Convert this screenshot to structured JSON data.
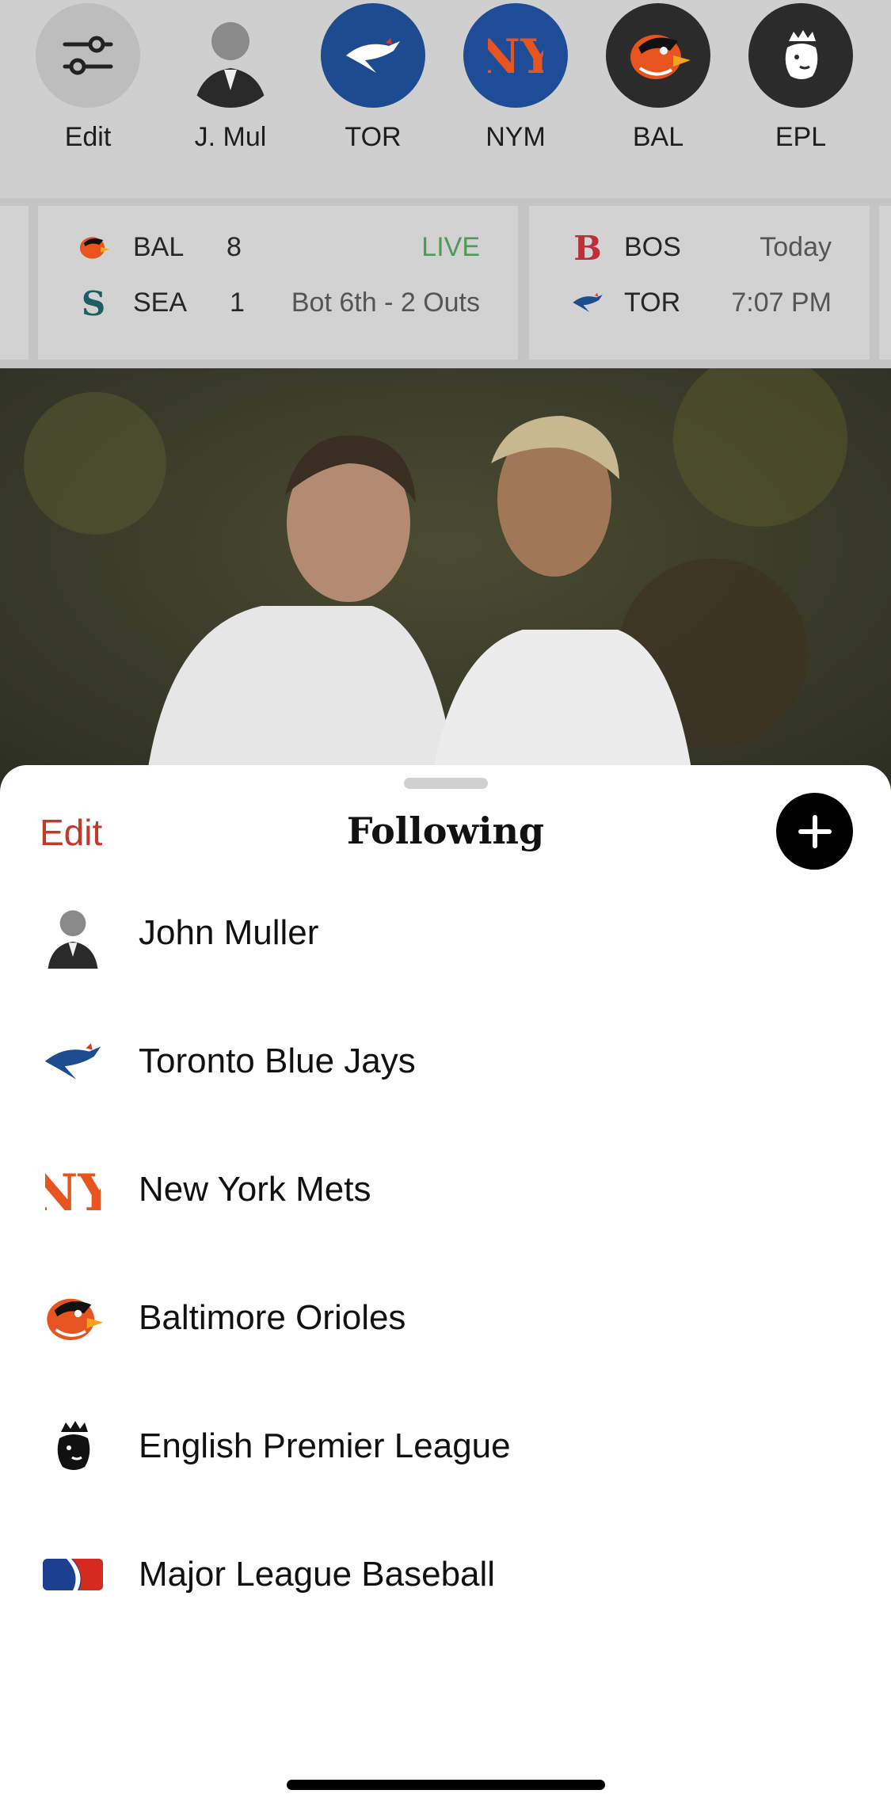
{
  "favorites": [
    {
      "label": "Edit",
      "icon": "sliders-icon"
    },
    {
      "label": "J. Mul",
      "icon": "person-avatar"
    },
    {
      "label": "TOR",
      "icon": "blue-jays-logo"
    },
    {
      "label": "NYM",
      "icon": "mets-logo"
    },
    {
      "label": "BAL",
      "icon": "orioles-logo"
    },
    {
      "label": "EPL",
      "icon": "premier-league-logo"
    }
  ],
  "scores": [
    {
      "teams": [
        {
          "abbr": "BAL",
          "score": "8",
          "status": "LIVE"
        },
        {
          "abbr": "SEA",
          "score": "1",
          "status": "Bot 6th - 2 Outs"
        }
      ]
    },
    {
      "teams": [
        {
          "abbr": "BOS",
          "score": "",
          "status": "Today"
        },
        {
          "abbr": "TOR",
          "score": "",
          "status": "7:07 PM"
        }
      ]
    }
  ],
  "sheet": {
    "edit_label": "Edit",
    "title": "Following",
    "add_icon": "plus-icon"
  },
  "following": [
    {
      "name": "John Muller",
      "icon": "person-avatar"
    },
    {
      "name": "Toronto Blue Jays",
      "icon": "blue-jays-logo"
    },
    {
      "name": "New York Mets",
      "icon": "mets-logo"
    },
    {
      "name": "Baltimore Orioles",
      "icon": "orioles-logo"
    },
    {
      "name": "English Premier League",
      "icon": "premier-league-logo"
    },
    {
      "name": "Major League Baseball",
      "icon": "mlb-logo"
    }
  ],
  "colors": {
    "accent_red": "#c0392b",
    "live_green": "#4f9a5a",
    "tor_blue": "#1d4b8f",
    "nym_blue": "#1f4c97",
    "orange": "#e8541f"
  }
}
